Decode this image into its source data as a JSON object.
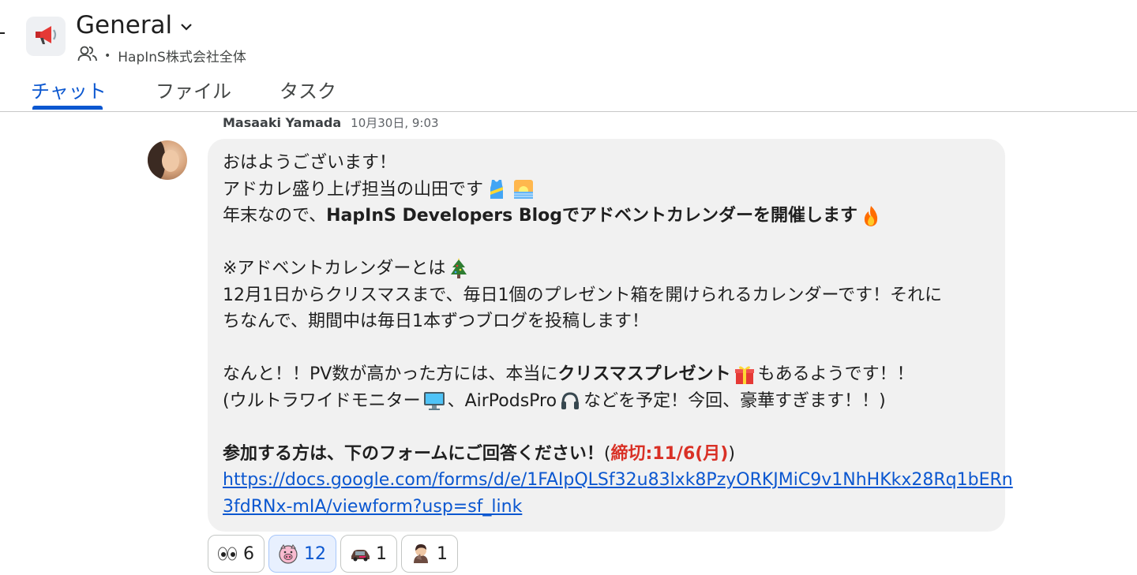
{
  "header": {
    "space_name": "General",
    "organization": "HapInS株式会社全体",
    "separator": "•",
    "space_icon": "megaphone-icon"
  },
  "tabs": [
    {
      "label": "チャット",
      "active": true
    },
    {
      "label": "ファイル",
      "active": false
    },
    {
      "label": "タスク",
      "active": false
    }
  ],
  "message": {
    "sender": "Masaaki Yamada",
    "timestamp": "10月30日, 9:03",
    "lines": {
      "l1": "おはようございます！",
      "l2": "アドカレ盛り上げ担当の山田です",
      "l3a": "年末なので、",
      "l3b": "HapInS Developers Blogでアドベントカレンダーを開催します",
      "l5": "※アドベントカレンダーとは",
      "l6": "12月1日からクリスマスまで、毎日1個のプレゼント箱を開けられるカレンダーです！それに",
      "l7": "ちなんで、期間中は毎日1本ずつブログを投稿します！",
      "l9a": "なんと！！PV数が高かった方には、本当に",
      "l9b": "クリスマスプレゼント",
      "l9c": "もあるようです！！",
      "l10a": "(ウルトラワイドモニター",
      "l10b": "、AirPodsPro",
      "l10c": "などを予定！今回、豪華すぎます！！)",
      "l12a": "参加する方は、下のフォームにご回答ください！",
      "l12b": "(",
      "l12c": "締切:11/6(月)",
      "l12d": ")",
      "link_line1": "https://docs.google.com/forms/d/e/1FAIpQLSf32u83lxk8PzyORKJMiC9v1NhHKkx28Rq1bERn",
      "link_line2": "3fdRNx-mIA/viewform?usp=sf_link"
    },
    "emojis": [
      "running-shirt-icon",
      "sunrise-icon",
      "fire-icon",
      "christmas-tree-icon",
      "gift-icon",
      "monitor-icon",
      "headphones-icon"
    ]
  },
  "reactions": [
    {
      "emoji": "eyes-icon",
      "count": "6",
      "active": false
    },
    {
      "emoji": "custom-pig-icon",
      "count": "12",
      "active": true
    },
    {
      "emoji": "custom-car-icon",
      "count": "1",
      "active": false
    },
    {
      "emoji": "custom-person-icon",
      "count": "1",
      "active": false
    }
  ],
  "colors": {
    "accent": "#0b57d0",
    "bubble_bg": "#f1f1f1",
    "deadline_red": "#d93025"
  }
}
